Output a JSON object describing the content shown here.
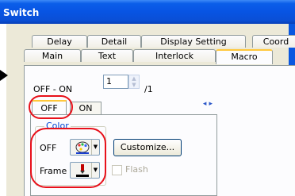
{
  "window": {
    "title": "Switch"
  },
  "tabs_row1": [
    {
      "label": "Delay"
    },
    {
      "label": "Detail"
    },
    {
      "label": "Display Setting"
    },
    {
      "label": "Coord"
    }
  ],
  "tabs_row2": [
    {
      "label": "Main"
    },
    {
      "label": "Text"
    },
    {
      "label": "Interlock"
    },
    {
      "label": "Macro"
    }
  ],
  "offon": {
    "label": "OFF - ON",
    "value": "1",
    "suffix": "/1"
  },
  "state_tabs": [
    {
      "label": "OFF",
      "selected": true
    },
    {
      "label": "ON",
      "selected": false
    }
  ],
  "color_group": {
    "legend": "Color",
    "off_label": "OFF",
    "frame_label": "Frame",
    "customize_label": "Customize...",
    "flash_label": "Flash",
    "off_icon": "palette-icon",
    "frame_icon": "pen-color-icon"
  },
  "accent": {
    "highlight": "#e8101a",
    "title_bar": "#0a4fd6"
  }
}
